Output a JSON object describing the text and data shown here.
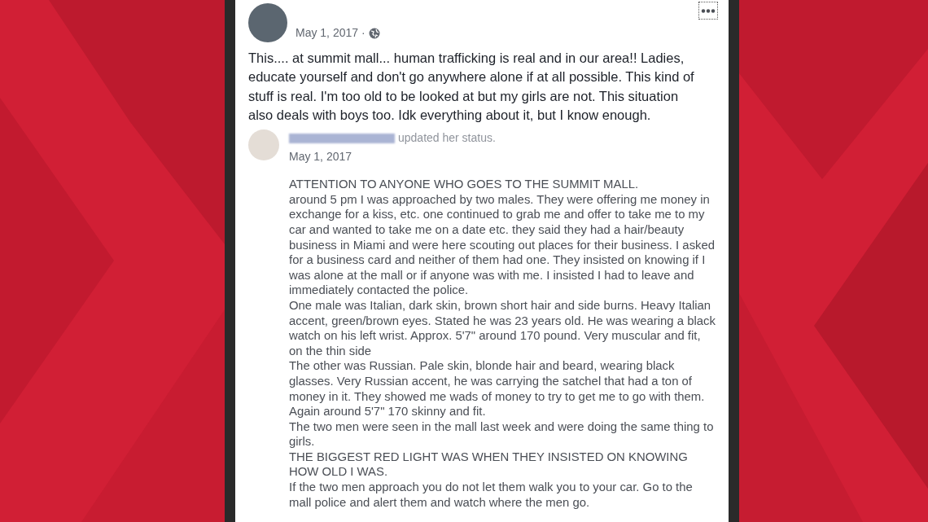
{
  "post": {
    "date": "May 1, 2017",
    "separator": "·",
    "text": "This.... at summit mall... human trafficking is real and in our area!! Ladies, educate yourself and don't go anywhere alone if at all possible. This kind of stuff is real. I'm too old to be looked at but my girls are not. This situation also deals with boys too. Idk everything about it, but I know enough."
  },
  "shared_post": {
    "action": "updated her status.",
    "date": "May 1, 2017",
    "paragraphs": [
      "ATTENTION TO ANYONE WHO GOES TO THE SUMMIT MALL.",
      "around 5 pm I was approached by two males. They were offering me money in exchange for a kiss, etc. one continued to grab me and offer to take me to my car and wanted to take me on a date etc. they said they had a hair/beauty business in Miami and were here scouting out places for their business. I asked for a business card and neither of them had one. They insisted on knowing if I was alone at the mall or if anyone was with me. I insisted I had to leave and immediately contacted the police.",
      "One male was Italian, dark skin, brown short hair and side burns. Heavy Italian accent, green/brown eyes. Stated he was 23 years old. He was wearing a black watch on his left wrist. Approx. 5'7\" around 170 pound. Very muscular and fit, on the thin side",
      "The other was Russian. Pale skin, blonde hair and beard, wearing black glasses. Very Russian accent, he was carrying the satchel that had a ton of money in it. They showed me wads of money to try to get me to go with them. Again around 5'7\" 170 skinny and fit.",
      "The two men were seen in the mall last week and were doing the same thing to girls.",
      "THE BIGGEST RED LIGHT WAS WHEN THEY INSISTED ON KNOWING HOW OLD I WAS.",
      "If the two men approach you do not let them walk you to your car. Go to the mall police and alert them and watch where the men go."
    ]
  }
}
